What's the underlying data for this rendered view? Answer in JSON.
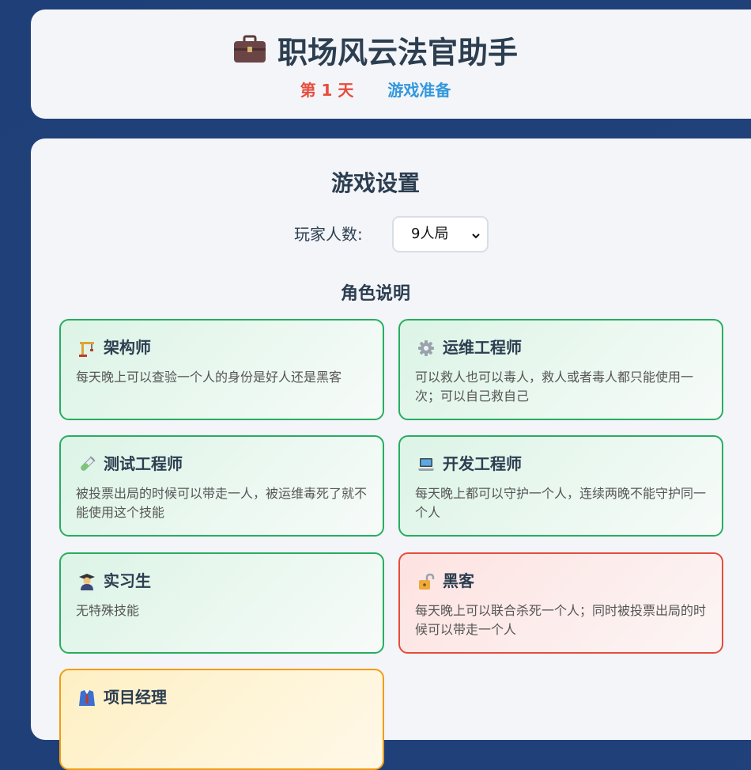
{
  "header": {
    "icon": "briefcase-icon",
    "title": "职场风云法官助手",
    "day": "第 1 天",
    "phase": "游戏准备"
  },
  "setup": {
    "title": "游戏设置",
    "player_count_label": "玩家人数:",
    "player_count_value": "9人局"
  },
  "roles": {
    "title": "角色说明",
    "items": [
      {
        "name": "架构师",
        "icon": "construction-crane-icon",
        "desc": "每天晚上可以查验一个人的身份是好人还是黑客",
        "team": "good"
      },
      {
        "name": "运维工程师",
        "icon": "gear-icon",
        "desc": "可以救人也可以毒人，救人或者毒人都只能使用一次；可以自己救自己",
        "team": "good"
      },
      {
        "name": "测试工程师",
        "icon": "test-tube-icon",
        "desc": "被投票出局的时候可以带走一人，被运维毒死了就不能使用这个技能",
        "team": "good"
      },
      {
        "name": "开发工程师",
        "icon": "laptop-icon",
        "desc": "每天晚上都可以守护一个人，连续两晚不能守护同一个人",
        "team": "good"
      },
      {
        "name": "实习生",
        "icon": "student-icon",
        "desc": "无特殊技能",
        "team": "good"
      },
      {
        "name": "黑客",
        "icon": "unlock-icon",
        "desc": "每天晚上可以联合杀死一个人；同时被投票出局的时候可以带走一个人",
        "team": "bad"
      },
      {
        "name": "项目经理",
        "icon": "suit-icon",
        "desc": "",
        "team": "neutral"
      }
    ]
  },
  "colors": {
    "background": "#1f3f78",
    "day": "#e74c3c",
    "phase": "#3498db",
    "good_border": "#27ae60",
    "bad_border": "#e74c3c",
    "neutral_border": "#f39c12"
  }
}
